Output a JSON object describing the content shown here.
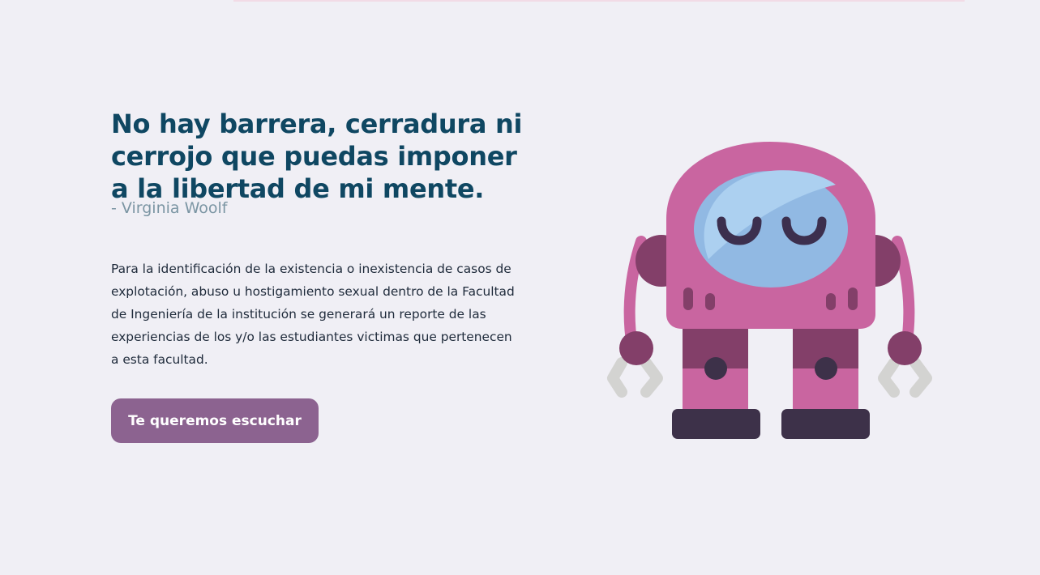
{
  "hero": {
    "quote": "No hay barrera, cerradura ni cerrojo que puedas imponer a la libertad de mi mente.",
    "author": "- Virginia Woolf",
    "description": "Para la identificación de la existencia o inexistencia de casos de explotación, abuso u hostigamiento sexual dentro de la Facultad de Ingeniería de la institución se generará un reporte de las experiencias de los y/o las estudiantes victimas que pertenecen a esta facultad.",
    "cta_label": "Te queremos escuchar"
  },
  "illustration": {
    "icon": "robot-illustration",
    "colors": {
      "body": "#c965a0",
      "dark_body": "#833f69",
      "visor": "#91b9e3",
      "visor_highlight": "#acd0f0",
      "eyes": "#3c2f4e",
      "feet": "#3d3149",
      "claws": "#d3d3d1"
    }
  },
  "theme": {
    "background": "#f0eff5",
    "heading_color": "#0f4762",
    "author_color": "#7b95a3",
    "text_color": "#1e2a3a",
    "button_color": "#8c6390"
  }
}
